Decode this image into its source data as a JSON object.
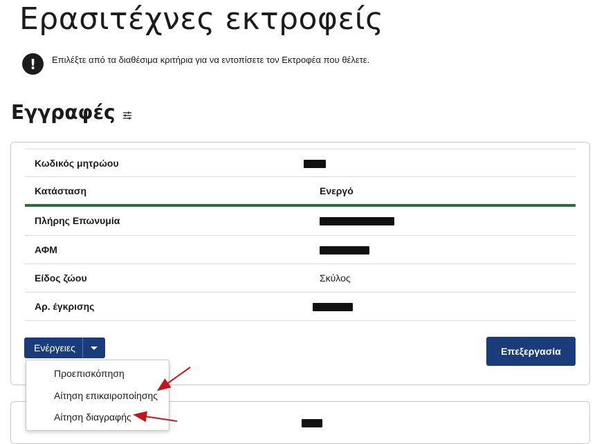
{
  "page": {
    "title": "Ερασιτέχνες εκτροφείς"
  },
  "notice": {
    "text": "Επιλέξτε από τα διαθέσιμα κριτήρια για να εντοπίσετε τον Εκτροφέα που θέλετε.",
    "icon": "exclamation-icon"
  },
  "section": {
    "title": "Εγγραφές",
    "filter_icon": "sliders-icon"
  },
  "record": {
    "registry_code_label": "Κωδικός μητρώου",
    "status_label": "Κατάσταση",
    "status_value": "Ενεργό",
    "full_name_label": "Πλήρης Επωνυμία",
    "afm_label": "ΑΦΜ",
    "animal_type_label": "Είδος ζώου",
    "animal_type_value": "Σκύλος",
    "approval_no_label": "Αρ. έγκρισης"
  },
  "actions": {
    "dropdown_label": "Ενέργειες",
    "edit_label": "Επεξεργασία",
    "menu": [
      "Προεπισκόπηση",
      "Αίτηση επικαιροποίησης",
      "Αίτηση διαγραφής"
    ]
  },
  "colors": {
    "primary": "#1a3c7a",
    "status_line": "#2e6b3c",
    "annotation_arrow": "#c0161c"
  }
}
